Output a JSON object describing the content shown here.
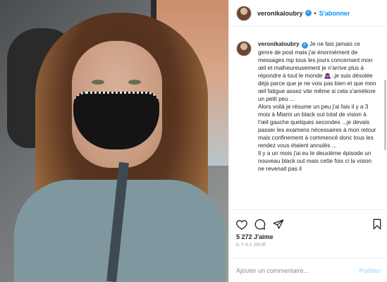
{
  "post": {
    "username": "veronikaloubry",
    "separator": "•",
    "follow_label": "S'abonner",
    "verified_icon": "✓",
    "caption_text": " Je ne fais jamais ce genre de post mais j'ai énormément de messages mp tous les jours concernant mon œil et malheureusement je n'arrive plus à répondre à tout le monde 🙇🏽‍♀️..je suis désolée déjà parce que je ne vois pas bien et que mon œil fatigue assez vite même si cela s'améliore un petit peu ...\nAlors voilà je résume un peu j'ai fais il y a 3 mois à Miami un black out total de vision à l'œil gauche quelques secondes ...je devais passer les examens nécessaires à mon retour mais confinement à commencé donc tous les rendez vous étaient annulés ...\nIl y a un mois j'ai eu le deuxième épisode un nouveau black out mais cette fois ci la vision ne revenait pas il",
    "likes": "5 272 J'aime",
    "time_ago": "IL Y A 1 JOUR"
  },
  "comment": {
    "placeholder": "Ajouter un commentaire...",
    "publish_label": "Publier"
  },
  "icons": {
    "like": "heart-icon",
    "comment": "comment-icon",
    "share": "share-icon",
    "save": "bookmark-icon",
    "verified": "verified-badge-icon"
  },
  "colors": {
    "accent": "#0095f6",
    "verified": "#3897f0",
    "publish_disabled": "#b2dffc",
    "muted": "#8e8e8e"
  }
}
